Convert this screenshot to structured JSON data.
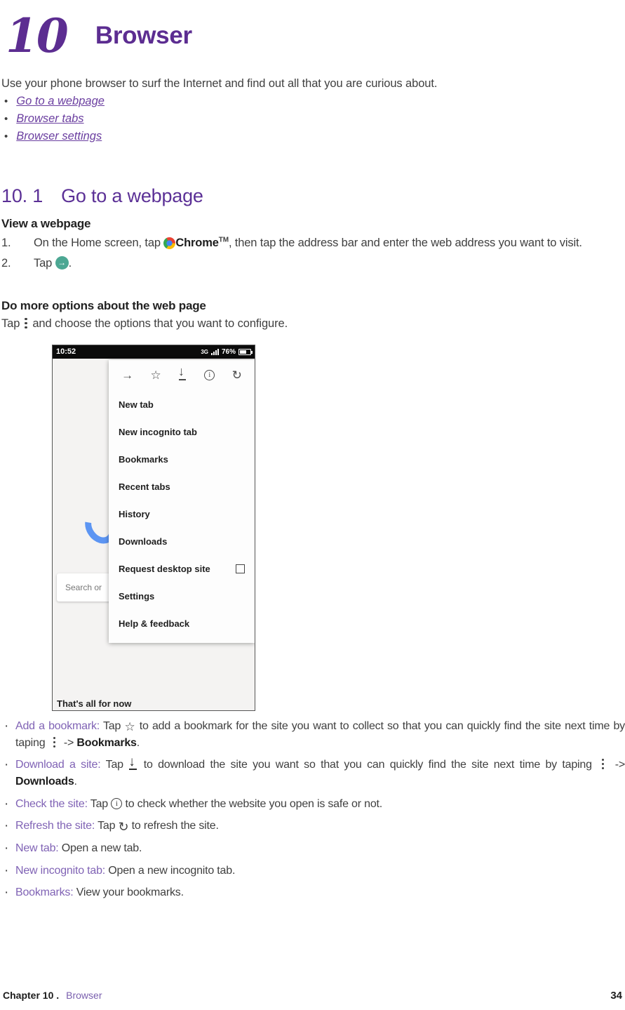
{
  "chapter": {
    "number": "10",
    "title": "Browser"
  },
  "intro": {
    "paragraph": "Use your phone browser to surf the Internet and find out all that you are curious about.",
    "links": [
      {
        "label": "Go to a webpage"
      },
      {
        "label": "Browser tabs"
      },
      {
        "label": "Browser settings"
      }
    ]
  },
  "section": {
    "number": "10. 1",
    "title": "Go to a webpage",
    "subhead_view": "View a webpage",
    "steps": [
      {
        "num": "1.",
        "pre": "On the Home screen, tap ",
        "bold": "Chrome",
        "tm": "TM",
        "post": ", then tap the address bar and enter the web address you want to visit."
      },
      {
        "num": "2.",
        "pre": "Tap ",
        "post": "."
      }
    ],
    "subhead_more": "Do more options about the web page",
    "more_pre": "Tap",
    "more_post": "and choose the options that you want to configure."
  },
  "screenshot": {
    "status": {
      "time": "10:52",
      "network": "3G",
      "battery_percent": "76%"
    },
    "search_placeholder": "Search or",
    "tagline": "That's all for now",
    "toolbar_icons": [
      "forward-arrow-icon",
      "star-icon",
      "download-icon",
      "info-icon",
      "refresh-icon"
    ],
    "menu_items": [
      {
        "label": "New tab",
        "checkbox": false
      },
      {
        "label": "New incognito tab",
        "checkbox": false
      },
      {
        "label": "Bookmarks",
        "checkbox": false
      },
      {
        "label": "Recent tabs",
        "checkbox": false
      },
      {
        "label": "History",
        "checkbox": false
      },
      {
        "label": "Downloads",
        "checkbox": false
      },
      {
        "label": "Request desktop site",
        "checkbox": true
      },
      {
        "label": "Settings",
        "checkbox": false
      },
      {
        "label": "Help & feedback",
        "checkbox": false
      }
    ]
  },
  "features": [
    {
      "lead": "Add a bookmark:",
      "t1": " Tap ",
      "t2": " to add a bookmark for the site you want to collect so that you can quickly find the site next time by taping ",
      "t3": " -> ",
      "bold": "Bookmarks",
      "t4": "."
    },
    {
      "lead": "Download a site:",
      "t1": " Tap ",
      "t2": " to download the site you want so that you can quickly find the site next time by taping ",
      "t3": " -> ",
      "bold": "Downloads",
      "t4": "."
    },
    {
      "lead": "Check the site:",
      "t1": " Tap ",
      "t2": " to check whether the website you open is safe or not."
    },
    {
      "lead": "Refresh the site:",
      "t1": " Tap ",
      "t2": " to refresh the site."
    },
    {
      "lead": "New tab:",
      "t1": " Open a new tab."
    },
    {
      "lead": "New incognito tab:",
      "t1": " Open a new incognito tab."
    },
    {
      "lead": "Bookmarks:",
      "t1": " View your bookmarks."
    }
  ],
  "footer": {
    "chapter_label": "Chapter 10 .",
    "crumb": "Browser",
    "page_number": "34"
  },
  "colors": {
    "purple_heading": "#5C2D91",
    "purple_link": "#6b3fa0",
    "purple_lead": "#8063b5",
    "accent_green": "#4CA793"
  }
}
